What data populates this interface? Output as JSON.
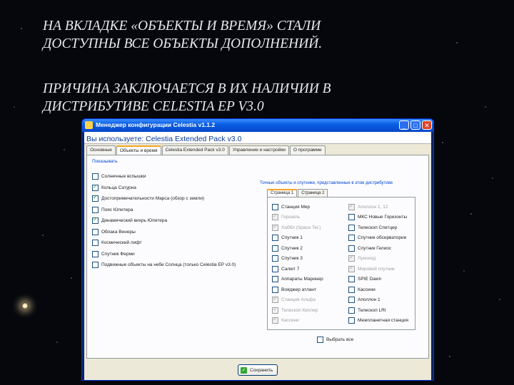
{
  "slide": {
    "title1_line1": "НА ВКЛАДКЕ «ОБЪЕКТЫ И ВРЕМЯ» СТАЛИ",
    "title1_line2": "ДОСТУПНЫ ВСЕ ОБЪЕКТЫ ДОПОЛНЕНИЙ.",
    "title2_line1": "ПРИЧИНА ЗАКЛЮЧАЕТСЯ В ИХ НАЛИЧИИ В",
    "title2_line2": "ДИСТРИБУТИВЕ CELESTIA EP V3.0"
  },
  "window": {
    "title": "Менеджер конфигурации Celestia v1.1.2",
    "header": "Вы используете: Celestia Extended Pack v3.0",
    "tabs": [
      "Основные",
      "Объекты и время",
      "Celestia Extended Pack v3.0",
      "Управление и настройки",
      "О программе"
    ],
    "active_tab": 1,
    "group_label": "Показывать",
    "left_items": [
      {
        "label": "Солнечные вспышки",
        "checked": false
      },
      {
        "label": "Кольца Сатурна",
        "checked": true
      },
      {
        "label": "Достопримечательности Марса (обзор с земли)",
        "checked": true
      },
      {
        "label": "Пояс Юпитера",
        "checked": false
      },
      {
        "label": "Динамический вихрь Юпитера",
        "checked": true
      },
      {
        "label": "Облака Венеры",
        "checked": false
      },
      {
        "label": "Космический лифт",
        "checked": false
      },
      {
        "label": "Спутник Ферми",
        "checked": false
      },
      {
        "label": "Подвижные объекты на небе Солнца (только Celestia EP v3.0)",
        "checked": false
      }
    ],
    "right_hint": "Точные объекты и спутники, представленные в этом дистрибутиве",
    "subtabs": [
      "Страница 1",
      "Страница 2"
    ],
    "col1": [
      {
        "label": "Станция Мир",
        "checked": false,
        "disabled": false
      },
      {
        "label": "Гершель",
        "checked": true,
        "disabled": true
      },
      {
        "label": "Хаббл (Space Tel.)",
        "checked": true,
        "disabled": true
      },
      {
        "label": "Спутник 1",
        "checked": false,
        "disabled": false
      },
      {
        "label": "Спутник 2",
        "checked": false,
        "disabled": false
      },
      {
        "label": "Спутник 3",
        "checked": false,
        "disabled": false
      },
      {
        "label": "Салют 7",
        "checked": false,
        "disabled": false
      },
      {
        "label": "Аппараты Маринер",
        "checked": false,
        "disabled": false
      },
      {
        "label": "Вояджер атлант",
        "checked": false,
        "disabled": false
      },
      {
        "label": "Станция Альфа",
        "checked": true,
        "disabled": true
      },
      {
        "label": "Телескоп Кеплер",
        "checked": true,
        "disabled": true
      },
      {
        "label": "Кассини",
        "checked": true,
        "disabled": true
      }
    ],
    "col2": [
      {
        "label": "Аполлон 1, 12",
        "checked": true,
        "disabled": true
      },
      {
        "label": "МКС Новые Горизонты",
        "checked": false,
        "disabled": false
      },
      {
        "label": "Телескоп Спитцер",
        "checked": false,
        "disabled": false
      },
      {
        "label": "Спутник обсерватории",
        "checked": false,
        "disabled": false
      },
      {
        "label": "Спутник Гелиос",
        "checked": false,
        "disabled": false
      },
      {
        "label": "Луноход",
        "checked": true,
        "disabled": true
      },
      {
        "label": "Мировой спутник",
        "checked": true,
        "disabled": true
      },
      {
        "label": "SPIE Dawn",
        "checked": false,
        "disabled": false
      },
      {
        "label": "Кассини",
        "checked": false,
        "disabled": false
      },
      {
        "label": "Аполлон 1",
        "checked": false,
        "disabled": false
      },
      {
        "label": "Телескоп LRI",
        "checked": false,
        "disabled": false
      },
      {
        "label": "Межпланетная станция",
        "checked": false,
        "disabled": false
      }
    ],
    "select_all": "Выбрать все",
    "save_label": "Сохранить"
  }
}
